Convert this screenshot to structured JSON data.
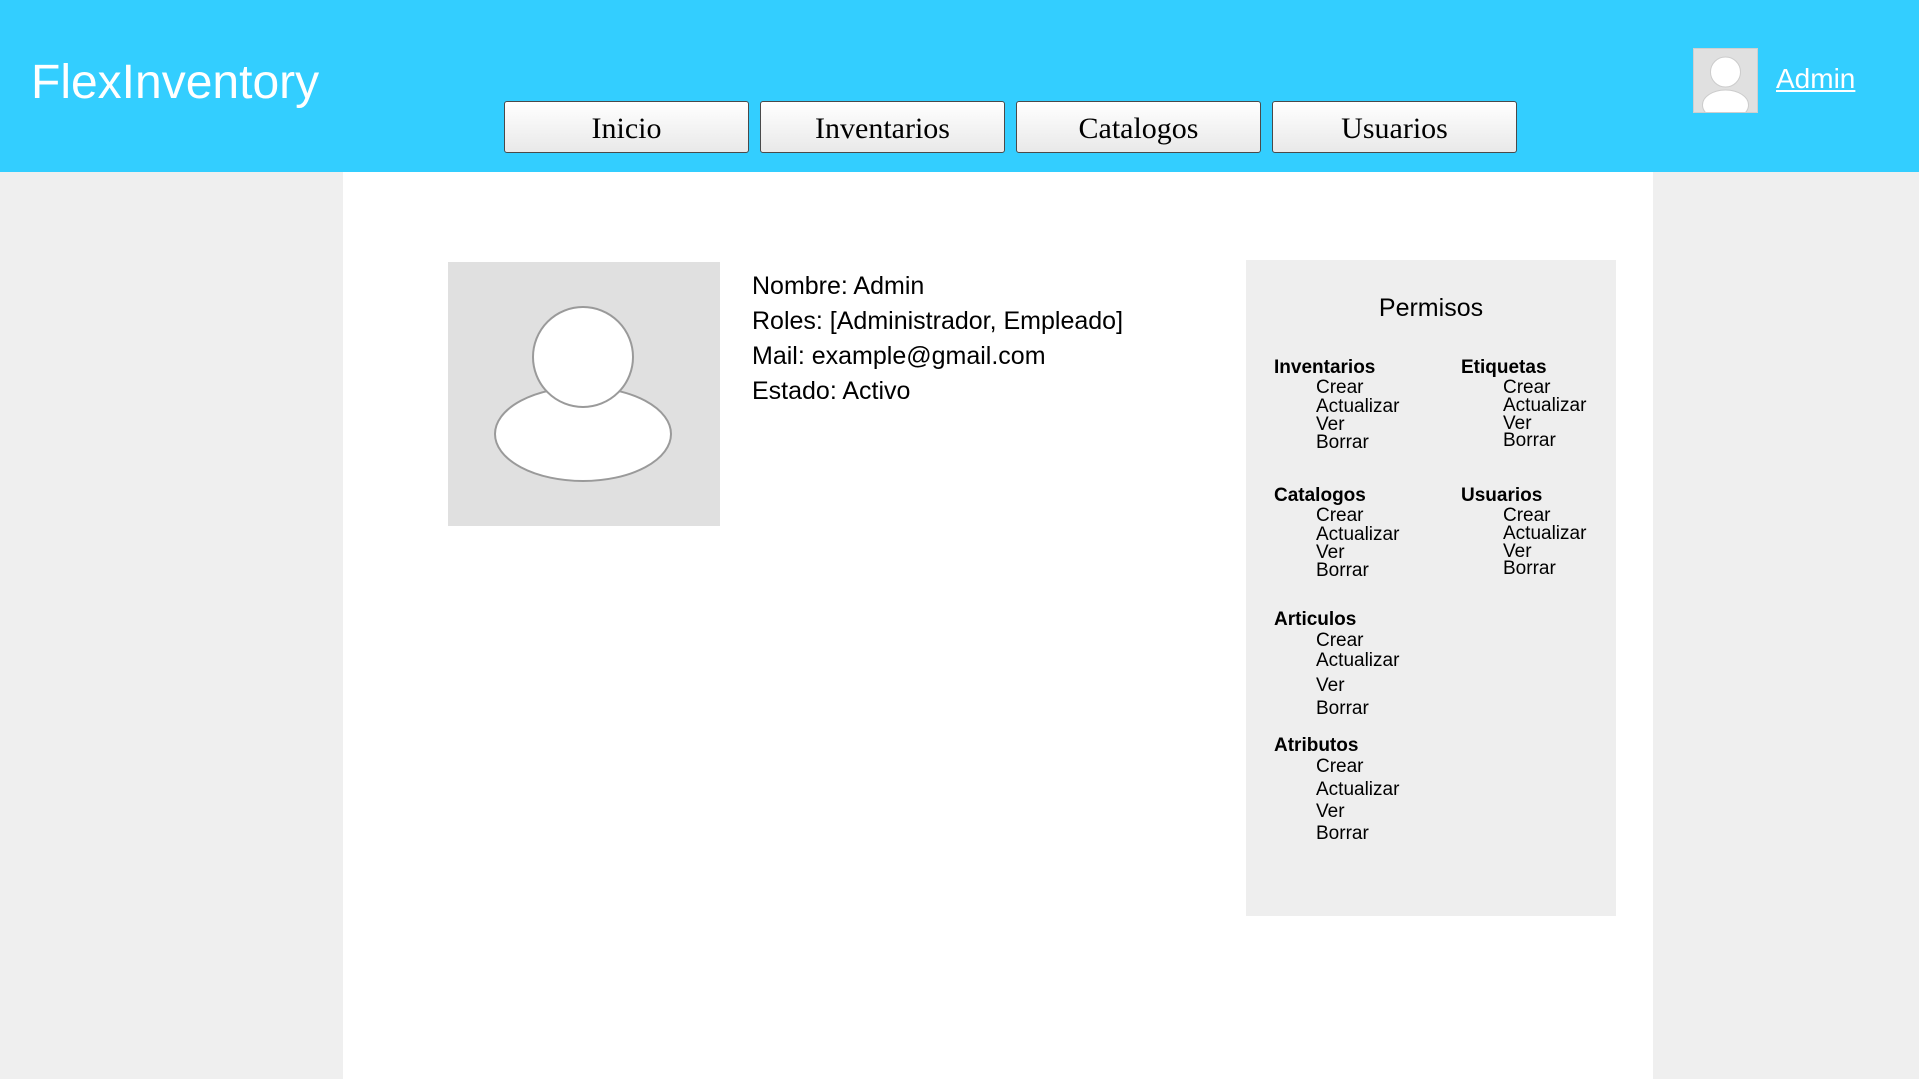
{
  "header": {
    "app_title": "FlexInventory",
    "nav": [
      "Inicio",
      "Inventarios",
      "Catalogos",
      "Usuarios"
    ],
    "user_link": "Admin"
  },
  "profile": {
    "nombre": "Nombre: Admin",
    "roles": "Roles: [Administrador, Empleado]",
    "mail": "Mail: example@gmail.com",
    "estado": "Estado: Activo"
  },
  "permissions": {
    "title": "Permisos",
    "groups": [
      {
        "name": "Inventarios",
        "items": [
          "Crear",
          "Actualizar",
          "Ver",
          "Borrar"
        ]
      },
      {
        "name": "Etiquetas",
        "items": [
          "Crear",
          "Actualizar",
          "Ver",
          "Borrar"
        ]
      },
      {
        "name": "Catalogos",
        "items": [
          "Crear",
          "Actualizar",
          "Ver",
          "Borrar"
        ]
      },
      {
        "name": "Usuarios",
        "items": [
          "Crear",
          "Actualizar",
          "Ver",
          "Borrar"
        ]
      },
      {
        "name": "Articulos",
        "items": [
          "Crear",
          "Actualizar",
          "Ver",
          "Borrar"
        ]
      },
      {
        "name": "Atributos",
        "items": [
          "Crear",
          "Actualizar",
          "Ver",
          "Borrar"
        ]
      }
    ]
  },
  "colors": {
    "header_bg": "#33ceff",
    "page_bg": "#efefef",
    "panel_bg": "#ffffff",
    "permissions_bg": "#eeeeee"
  },
  "icons": {
    "header_avatar": "user-avatar-icon",
    "profile_photo": "user-silhouette-icon"
  }
}
